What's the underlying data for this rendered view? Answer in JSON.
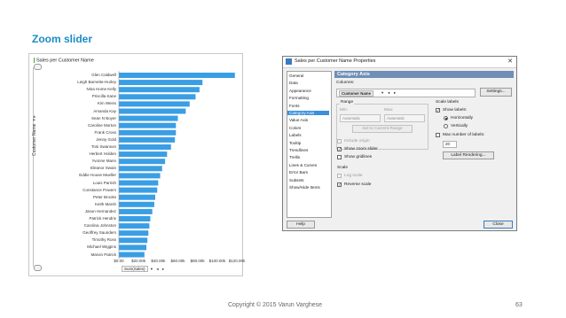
{
  "slide": {
    "title": "Zoom slider",
    "copyright": "Copyright © 2015 Varun Varghese",
    "page_number": "63"
  },
  "chart": {
    "title": "Sales per Customer Name",
    "y_axis_label": "Customer Name",
    "y_axis_arrows": "▾ ▸",
    "x_axis_control": "Sum(Sales)",
    "x_axis_control_arrows": [
      "▾",
      "◂",
      "▸"
    ],
    "zoom_slider": {
      "start_fraction": 0.0,
      "end_fraction": 1.0
    },
    "bar_color": "#3a9ee4"
  },
  "chart_data": {
    "type": "bar",
    "orientation": "horizontal",
    "title": "Sales per Customer Name",
    "xlabel": "Sum(Sales)",
    "ylabel": "Customer Name",
    "xlim": [
      0,
      120000
    ],
    "x_ticks": [
      "$0.00",
      "$20.00k",
      "$40.00k",
      "$60.00k",
      "$80.00k",
      "$100.00k",
      "$120.00k"
    ],
    "categories": [
      "Glen Caldwell",
      "Leigh Barnette-Hurley",
      "Nina Home Kelly",
      "Priscilla Kane",
      "Kim Weiss",
      "Amanda Kay",
      "Sean N Boyer",
      "Caroline Morton",
      "Frank Cross",
      "Jenny Gold",
      "Toni Swanson",
      "Herbert Holden",
      "Yvonne Mann",
      "Eleanor Swain",
      "Eddie House Mueller",
      "Louis Parrish",
      "Constance Powers",
      "Peter Brooks",
      "Keith Marsh",
      "Jason Hernandez",
      "Patrick Hendrix",
      "Carolina Johnston",
      "Geoffrey Saunders",
      "Timothy Ross",
      "Michael Wiggins",
      "Marvin Patrick"
    ],
    "values": [
      118000,
      85000,
      82000,
      78000,
      72000,
      68000,
      60000,
      58000,
      58000,
      57000,
      53000,
      49000,
      47000,
      44000,
      42000,
      40000,
      39000,
      37000,
      36000,
      34000,
      32000,
      31000,
      30000,
      29000,
      28000,
      26000
    ],
    "grid": false,
    "legend": "none"
  },
  "dialog": {
    "title": "Sales per Customer Name Properties",
    "close_glyph": "✕",
    "nav_items": [
      "General",
      "Data",
      "Appearance",
      "Formatting",
      "Fonts",
      "Category Axis",
      "Value Axis",
      "Colors",
      "Labels",
      "Tooltip",
      "Trendlines",
      "Trellis",
      "Lines & Curves",
      "Error Bars",
      "Subsets",
      "Show/Hide Items"
    ],
    "selected_nav": "Category Axis",
    "panel_header": "Category Axis",
    "columns_label": "Columns:",
    "column_token": "Customer Name",
    "column_token_arrows": [
      "▾",
      "◂",
      "▸"
    ],
    "settings_button": "Settings...",
    "range_label": "Range",
    "min_label": "Min:",
    "max_label": "Max:",
    "min_value": "Automatic",
    "max_value": "Automatic",
    "set_range_button": "Set to Current Range",
    "include_origin": "Include origin",
    "show_zoom_slider": "Show zoom slider",
    "show_gridlines": "Show gridlines",
    "scale_label": "Scale",
    "log_scale": "Log scale",
    "reverse_scale": "Reverse scale",
    "scale_labels_label": "Scale labels",
    "show_labels": "Show labels:",
    "horizontally": "Horizontally",
    "vertically": "Vertically",
    "max_number_of_labels": "Max number of labels:",
    "max_labels_value": "20",
    "label_rendering_button": "Label Rendering...",
    "help_button": "Help",
    "close_button": "Close",
    "check_mark": "✓",
    "states": {
      "include_origin": false,
      "show_zoom_slider": true,
      "show_gridlines": false,
      "log_scale": false,
      "reverse_scale": true,
      "show_labels": true,
      "max_number_of_labels": false,
      "orientation": "horizontally"
    }
  }
}
